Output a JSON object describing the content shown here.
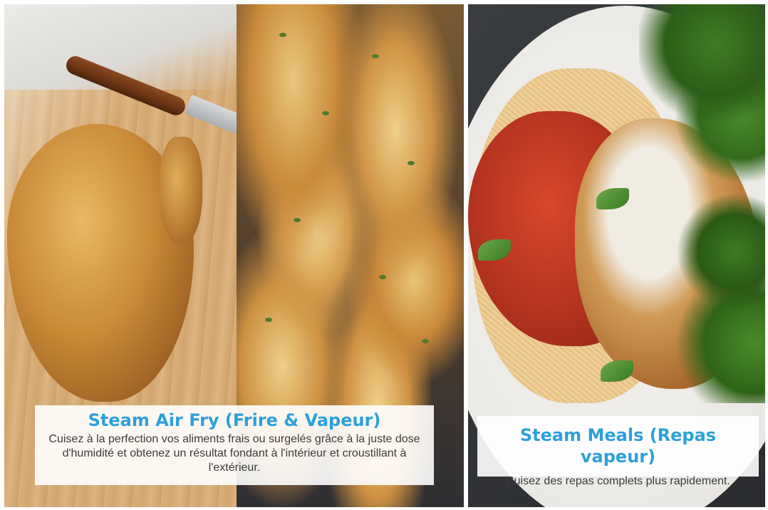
{
  "features": [
    {
      "id": "steam-air-fry",
      "title": "Steam Air Fry (Frire & Vapeur)",
      "description": "Cuisez à la perfection vos aliments frais ou surgelés grâce à la juste dose d'humidité et obtenez un résultat fondant à l'intérieur et croustillant à l'extérieur."
    },
    {
      "id": "steam-meals",
      "title": "Steam Meals (Repas vapeur)",
      "description": "Cuisez des repas complets plus rapidement."
    }
  ],
  "colors": {
    "title_accent": "#2da0da",
    "body_text": "#3c3c3c",
    "caption_background": "#ffffff"
  }
}
